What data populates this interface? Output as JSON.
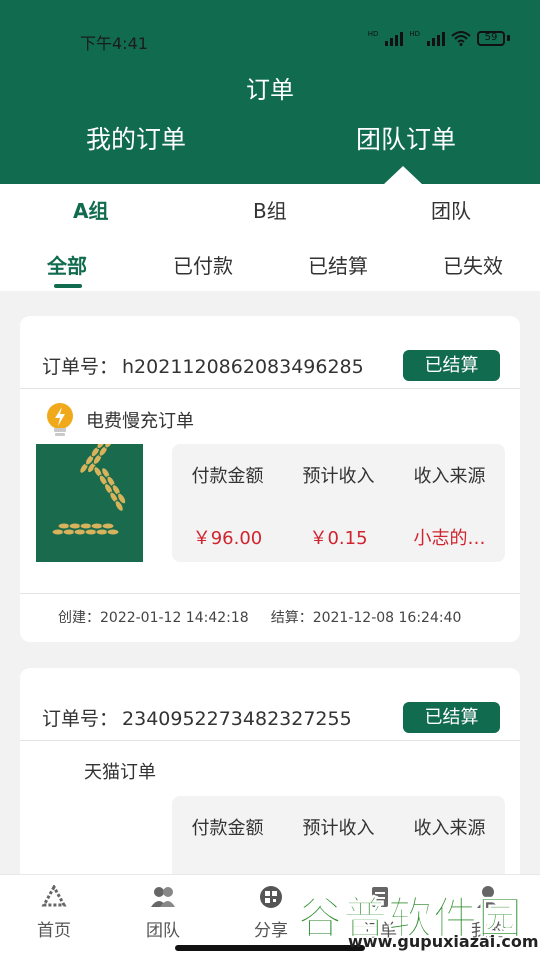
{
  "status_bar": {
    "time": "下午4:41",
    "battery": "59"
  },
  "header": {
    "title": "订单",
    "tabs": [
      {
        "label": "我的订单"
      },
      {
        "label": "团队订单"
      }
    ],
    "active_tab": "团队订单"
  },
  "group_tabs": [
    {
      "label": "A组"
    },
    {
      "label": "B组"
    },
    {
      "label": "团队"
    }
  ],
  "filter_tabs": [
    {
      "label": "全部"
    },
    {
      "label": "已付款"
    },
    {
      "label": "已结算"
    },
    {
      "label": "已失效"
    }
  ],
  "orders": [
    {
      "order_label": "订单号：",
      "order_no": "h2021120862083496285",
      "status": "已结算",
      "type": "电费慢充订单",
      "stats": [
        {
          "label": "付款金额",
          "value": "￥96.00"
        },
        {
          "label": "预计收入",
          "value": "￥0.15"
        },
        {
          "label": "收入来源",
          "value": "小志的…"
        }
      ],
      "created": "创建：2022-01-12 14:42:18",
      "settled": "结算：2021-12-08 16:24:40"
    },
    {
      "order_label": "订单号：",
      "order_no": "2340952273482327255",
      "status": "已结算",
      "type": "天猫订单",
      "stats": [
        {
          "label": "付款金额"
        },
        {
          "label": "预计收入"
        },
        {
          "label": "收入来源"
        }
      ]
    }
  ],
  "bottom_nav": [
    {
      "label": "首页",
      "icon": "wheat-logo-icon"
    },
    {
      "label": "团队",
      "icon": "team-icon"
    },
    {
      "label": "分享",
      "icon": "qr-share-icon"
    },
    {
      "label": "订单",
      "icon": "order-icon"
    },
    {
      "label": "我的",
      "icon": "user-icon"
    }
  ],
  "watermark": {
    "main": "谷普软件园",
    "url": "www.gupuxiazai.com"
  },
  "colors": {
    "brand_green": "#116b4e",
    "price_red": "#d0242f",
    "background": "#f2f2f2"
  }
}
